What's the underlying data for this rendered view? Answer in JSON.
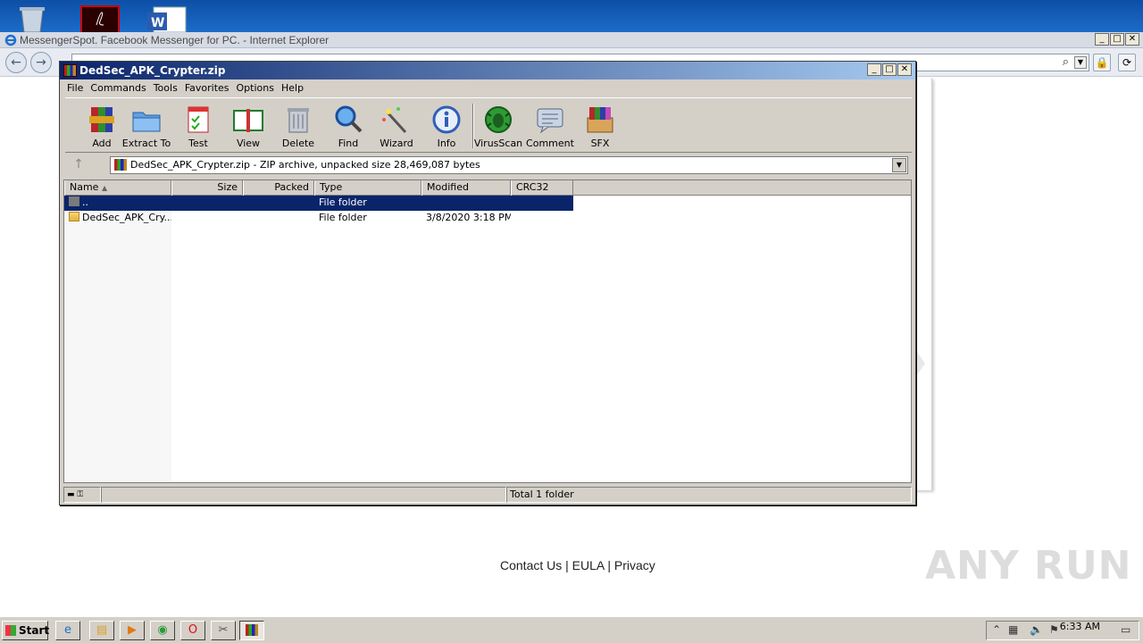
{
  "ie": {
    "title": "MessengerSpot. Facebook Messenger for PC. - Internet Explorer",
    "footer": "Contact Us | EULA | Privacy"
  },
  "watermark": "ANY RUN",
  "rar": {
    "title": "DedSec_APK_Crypter.zip",
    "menu": [
      "File",
      "Commands",
      "Tools",
      "Favorites",
      "Options",
      "Help"
    ],
    "toolbar": [
      "Add",
      "Extract To",
      "Test",
      "View",
      "Delete",
      "Find",
      "Wizard",
      "Info",
      "VirusScan",
      "Comment",
      "SFX"
    ],
    "path": "DedSec_APK_Crypter.zip - ZIP archive, unpacked size 28,469,087 bytes",
    "columns": [
      "Name",
      "Size",
      "Packed",
      "Type",
      "Modified",
      "CRC32"
    ],
    "rows": [
      {
        "name": "..",
        "size": "",
        "packed": "",
        "type": "File folder",
        "modified": "",
        "crc": ""
      },
      {
        "name": "DedSec_APK_Cry...",
        "size": "",
        "packed": "",
        "type": "File folder",
        "modified": "3/8/2020 3:18 PM",
        "crc": ""
      }
    ],
    "status": "Total 1 folder"
  },
  "taskbar": {
    "start": "Start",
    "clock": "6:33 AM"
  }
}
